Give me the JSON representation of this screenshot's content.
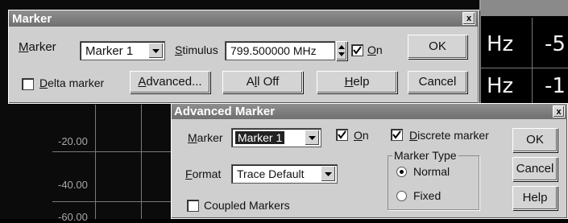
{
  "background": {
    "readouts": [
      "Hz",
      "-5",
      "Hz",
      "-1"
    ],
    "y_labels": [
      "-20.00",
      "-40.00",
      "-60.00"
    ]
  },
  "marker_dialog": {
    "title": "Marker",
    "close_label": "x",
    "marker_label": "Marker",
    "marker_value": "Marker 1",
    "stimulus_label": "Stimulus",
    "stimulus_value": "799.500000 MHz",
    "on_label": "On",
    "on_checked": true,
    "ok_label": "OK",
    "delta_label": "Delta marker",
    "delta_checked": false,
    "advanced_label": "Advanced...",
    "alloff_label": "All Off",
    "help_label": "Help",
    "cancel_label": "Cancel"
  },
  "advanced_dialog": {
    "title": "Advanced Marker",
    "close_label": "x",
    "marker_label": "Marker",
    "marker_value": "Marker 1",
    "on_label": "On",
    "on_checked": true,
    "discrete_label": "Discrete marker",
    "discrete_checked": true,
    "ok_label": "OK",
    "format_label": "Format",
    "format_value": "Trace Default",
    "marker_type_label": "Marker Type",
    "normal_label": "Normal",
    "fixed_label": "Fixed",
    "selected_type": "Normal",
    "cancel_label": "Cancel",
    "coupled_label": "Coupled Markers",
    "coupled_checked": false,
    "help_label": "Help"
  }
}
